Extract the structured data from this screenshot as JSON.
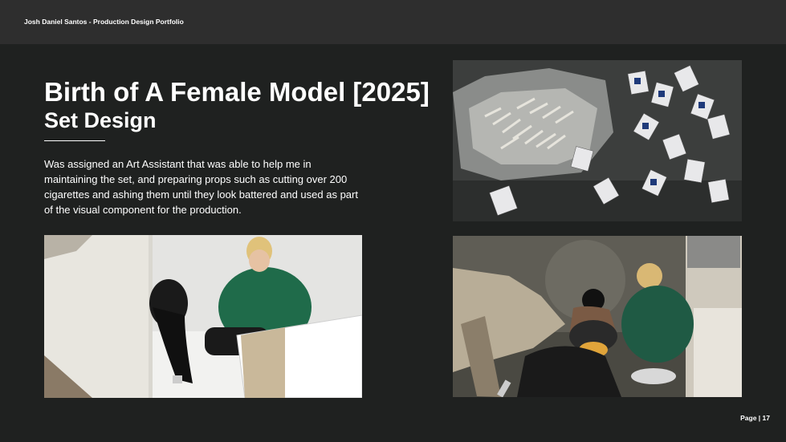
{
  "header": {
    "portfolio_title": "Josh Daniel Santos - Production Design Portfolio"
  },
  "main": {
    "title": "Birth of A Female Model [2025]",
    "subtitle": "Set Design",
    "description": "Was assigned an Art Assistant that was able to help me in maintaining the set, and preparing props such as cutting over 200 cigarettes and ashing them until they look battered and used as part of the visual component for the production."
  },
  "photos": {
    "cigarettes": "photo-cigarettes-on-foil",
    "set_prep": "photo-set-prep-white-studio",
    "crouching": "photo-crew-crouching"
  },
  "footer": {
    "page_label": "Page | 17"
  },
  "colors": {
    "background": "#1f2120",
    "topbar": "#2e2e2e",
    "text": "#ffffff"
  }
}
